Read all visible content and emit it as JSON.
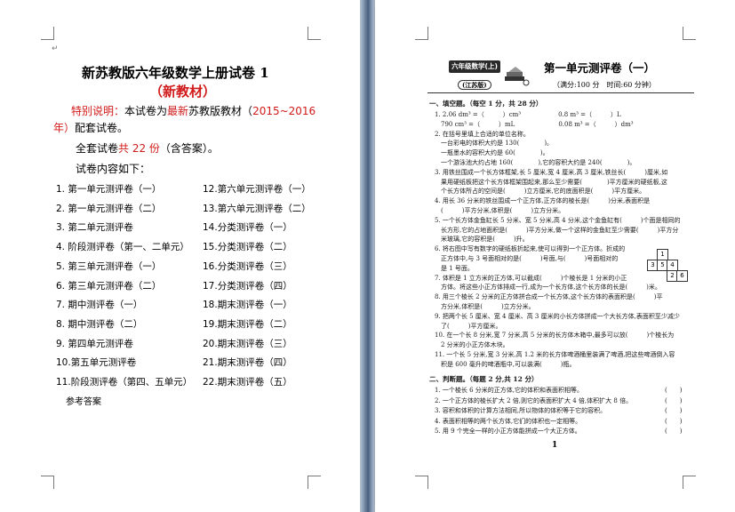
{
  "left_page": {
    "title": "新苏教版六年级数学上册试卷 1",
    "subtitle": "（新教材）",
    "note_line1_parts": [
      "特别说明：",
      "本试卷为",
      "最新",
      "苏教版教材（",
      "2015~2016",
      ""
    ],
    "note_line2_parts": [
      "年）",
      "配套试卷。"
    ],
    "total_parts": [
      "全套试卷",
      "共 22 份",
      "（含答案）。"
    ],
    "contents_heading": "试卷内容如下：",
    "toc_left": [
      "1. 第一单元测评卷（一）",
      "2. 第一单元测评卷（二）",
      "3. 第二单元测评卷",
      "4. 阶段测评卷（第一、二单元）",
      "5. 第三单元测评卷（一）",
      "6. 第三单元测评卷（二）",
      "7. 期中测评卷（一）",
      "8. 期中测评卷（二）",
      "9. 第四单元测评卷",
      "10.第五单元测评卷",
      "11.阶段测评卷（第四、五单元）"
    ],
    "toc_right": [
      "12.第六单元测评卷（一）",
      "13.第六单元测评卷（二）",
      "14.分类测评卷（一）",
      "15.分类测评卷（二）",
      "16.分类测评卷（三）",
      "17.分类测评卷（四）",
      "18.期末测评卷（一）",
      "19.期末测评卷（二）",
      "20.期末测评卷（三）",
      "21.期末测评卷（四）",
      "22.期末测评卷（五）"
    ],
    "answers_label": "参考答案"
  },
  "right_page": {
    "badge": "六年级数学(上)",
    "edition": "(江苏版)",
    "title": "第一单元测评卷（一）",
    "subtitle": "（满分:100 分　时间:60 分钟）",
    "section1_heading": "一、填空题。（每空 1 分，共 28 分）",
    "lines": [
      "1. 2.06 dm³ =（　　　）cm³　　　　　　0.8 m³ =（　　　）L",
      "　790 cm³ =（　　　）mL　　　　　　　0.08 m³ =（　　　）dm³",
      "2. 在括号里填上合适的单位名称。",
      "　一台彩电的体积大约是 130(　　　　)。",
      "　一瓶墨水的容积大约是 60(　　　　)。",
      "　一个游泳池大约占地 160(　　　　),它的容积大约是 240(　　　　)。",
      "3. 用铁丝围成一个长方体框架,长 5 厘米,宽 4 厘米,高 3 厘米,铁丝长(　　　)厘米,如",
      "　果用硬纸板把这个长方体框架围起来,那么至少需要(　　　　)平方厘米的硬纸板,这",
      "　个长方体所占的空间是(　　　)立方厘米,它的底面积是(　　　)平方厘米。",
      "4. 用长 36 分米的铁丝围成一个正方体,正方体的棱长是(　　　)分米,表面积是",
      "　(　　　)平方分米,体积是(　　　)立方分米。",
      "5. 一个长方体金鱼缸长 5 分米、宽 5 分米,高 4 分米,这个金鱼缸有(　　　)个面是相同的",
      "　长方形,它的占地面积是(　　　)平方分米,做一个这样的金鱼缸至少需要(　　　)平方分",
      "　米玻璃,它的容积是(　　　)升。",
      "6. 将右图中写有数字的硬纸板折起来,使可以得到一个正方体。折成的",
      "　正方体中,与 3 号面相对的是(　　　)号面,与(　　　)号面相对的",
      "　是 1 号面。",
      "7. 体积是 1 立方米的正方体,可以截成(　　　)个棱长是 1 分米的小正",
      "　方体。将这些小正方体排成一行,成为一个长方体,这个长方体的长是(　　　)米。",
      "8. 用三个棱长 2 分米的正方体拼合成一个长方体,这个长方体的表面积是(　　　)平",
      "　方分米,体积是(　　　)立方分米。",
      "9. 把两个长 5 厘米、宽 4 厘米、高 3 厘米的小长方体拼成一个大长方体,表面积至少减少",
      "　了(　　　)平方厘米。",
      "10. 在一个长 8 分米,宽 7 分米,高 5 分米的长方体木箱中,最多可以放(　　　)个棱长为",
      "　2 分米的小正方体木块。",
      "11. 一个长 5 分米,宽 3 分米,高 1.2 米的长方体啤酒桶里装满了啤酒,把这些啤酒倒入容",
      "　积是 600 毫升的啤酒瓶中,可以装满(　　　)瓶。"
    ],
    "section2_heading": "二、判断题。（每题 2 分,共 12 分）",
    "judge_items": [
      "1. 一个棱长 6 分米的正方体,它的体积和表面积相等。",
      "2. 一个正方体的棱长扩大 2 倍,则它的表面积扩大 4 倍,体积扩大 8 倍。",
      "3. 容积和体积的计算方法相同,所以物体的体积等于它的容积。",
      "4. 表面积相等的两个长方体,它们的体积也一定相等。",
      "5. 用 9 个完全一样的小正方体能拼成一个大正方体。"
    ],
    "judge_paren": "(　　)",
    "net_numbers": [
      "1",
      "3",
      "5",
      "4",
      "2",
      "6"
    ],
    "page_number": "1"
  },
  "colors": {
    "accent_red": "#d11a1a",
    "gutter_blue": "#5a6f8c"
  }
}
